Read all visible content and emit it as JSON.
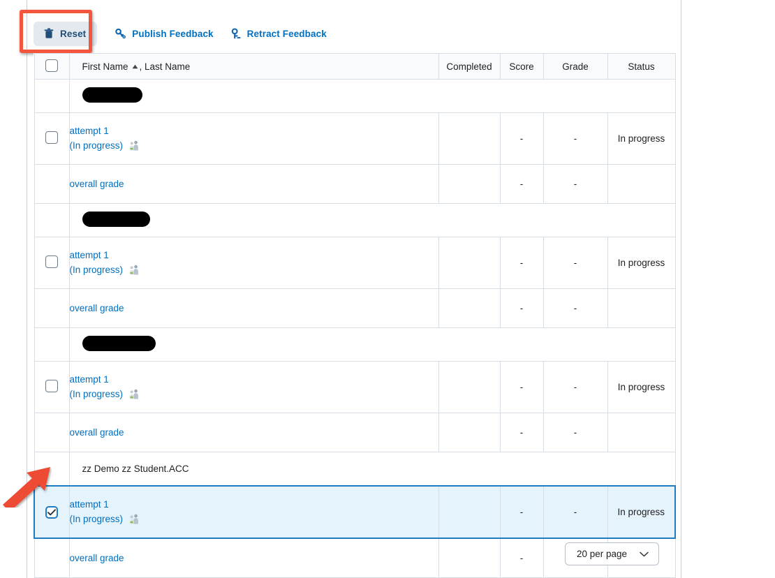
{
  "toolbar": {
    "reset_label": "Reset",
    "publish_label": "Publish Feedback",
    "retract_label": "Retract Feedback",
    "reset_icon": "trash-icon",
    "publish_icon": "key-publish-icon",
    "retract_icon": "key-retract-icon"
  },
  "table": {
    "headers": {
      "name": "First Name",
      "name_sep": ", Last Name",
      "sort_caret": "▲",
      "completed": "Completed",
      "score": "Score",
      "grade": "Grade",
      "status": "Status"
    },
    "groups": [
      {
        "student_name": "",
        "redacted": true,
        "redact_width": 86,
        "attempt": {
          "link": "attempt 1",
          "state": "(In progress)",
          "icon": "people-icon",
          "completed": "",
          "score": "-",
          "grade": "-",
          "status": "In progress",
          "checked": false,
          "selected": false
        },
        "overall": {
          "link": "overall grade",
          "completed": "",
          "score": "-",
          "grade": "-",
          "status": ""
        }
      },
      {
        "student_name": "",
        "redacted": true,
        "redact_width": 97,
        "attempt": {
          "link": "attempt 1",
          "state": "(In progress)",
          "icon": "people-icon",
          "completed": "",
          "score": "-",
          "grade": "-",
          "status": "In progress",
          "checked": false,
          "selected": false
        },
        "overall": {
          "link": "overall grade",
          "completed": "",
          "score": "-",
          "grade": "-",
          "status": ""
        }
      },
      {
        "student_name": "",
        "redacted": true,
        "redact_width": 105,
        "attempt": {
          "link": "attempt 1",
          "state": "(In progress)",
          "icon": "people-icon",
          "completed": "",
          "score": "-",
          "grade": "-",
          "status": "In progress",
          "checked": false,
          "selected": false
        },
        "overall": {
          "link": "overall grade",
          "completed": "",
          "score": "-",
          "grade": "-",
          "status": ""
        }
      },
      {
        "student_name": "zz Demo zz Student.ACC",
        "redacted": false,
        "redact_width": 0,
        "attempt": {
          "link": "attempt 1",
          "state": "(In progress)",
          "icon": "people-icon",
          "completed": "",
          "score": "-",
          "grade": "-",
          "status": "In progress",
          "checked": true,
          "selected": true
        },
        "overall": {
          "link": "overall grade",
          "completed": "",
          "score": "-",
          "grade": "-",
          "status": ""
        }
      }
    ]
  },
  "pagination": {
    "per_page_label": "20 per page",
    "chevron": "⌄"
  },
  "annotations": {
    "highlight_color": "#f4553d",
    "arrow_color": "#ee4b36"
  },
  "colors": {
    "link": "#006fbf",
    "selected_row_bg": "#e4f3fc",
    "selected_row_border": "#1f7bc2",
    "header_bg": "#f9fafb",
    "grid_border": "#d6dde4"
  }
}
